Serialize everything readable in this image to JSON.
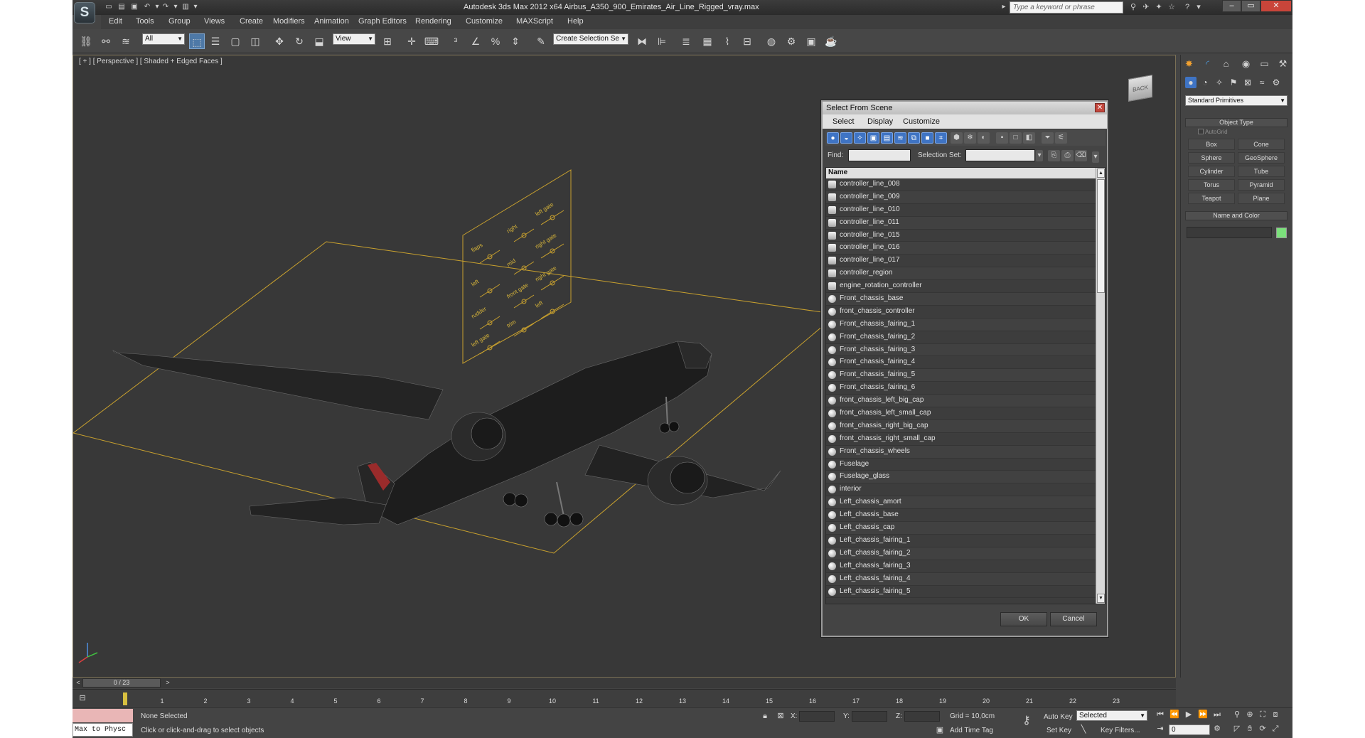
{
  "window": {
    "title": "Autodesk 3ds Max  2012 x64     Airbus_A350_900_Emirates_Air_Line_Rigged_vray.max",
    "search_placeholder": "Type a keyword or phrase",
    "app_logo": "S"
  },
  "menu": [
    "Edit",
    "Tools",
    "Group",
    "Views",
    "Create",
    "Modifiers",
    "Animation",
    "Graph Editors",
    "Rendering",
    "Customize",
    "MAXScript",
    "Help"
  ],
  "toolbar": {
    "filter_combo": "All",
    "ref_coord_combo": "View",
    "named_selection_combo": "Create Selection Se"
  },
  "viewport": {
    "label": "[ + ] [ Perspective ] [ Shaded + Edged Faces ]",
    "viewcube_label": "BACK",
    "rig_labels": [
      "flaps",
      "right",
      "left gate",
      "left",
      "mid",
      "right gate",
      "rudder",
      "front gate",
      "right gate",
      "left gate",
      "trim",
      "left"
    ]
  },
  "dialog": {
    "title": "Select From Scene",
    "menus": [
      "Select",
      "Display",
      "Customize"
    ],
    "find_label": "Find:",
    "selection_set_label": "Selection Set:",
    "column_header": "Name",
    "items": [
      "controller_line_008",
      "controller_line_009",
      "controller_line_010",
      "controller_line_011",
      "controller_line_015",
      "controller_line_016",
      "controller_line_017",
      "controller_region",
      "engine_rotation_controller",
      "Front_chassis_base",
      "front_chassis_controller",
      "Front_chassis_fairing_1",
      "Front_chassis_fairing_2",
      "Front_chassis_fairing_3",
      "Front_chassis_fairing_4",
      "Front_chassis_fairing_5",
      "Front_chassis_fairing_6",
      "front_chassis_left_big_cap",
      "front_chassis_left_small_cap",
      "front_chassis_right_big_cap",
      "front_chassis_right_small_cap",
      "Front_chassis_wheels",
      "Fuselage",
      "Fuselage_glass",
      "interior",
      "Left_chassis_amort",
      "Left_chassis_base",
      "Left_chassis_cap",
      "Left_chassis_fairing_1",
      "Left_chassis_fairing_2",
      "Left_chassis_fairing_3",
      "Left_chassis_fairing_4",
      "Left_chassis_fairing_5"
    ],
    "ok_label": "OK",
    "cancel_label": "Cancel"
  },
  "command_panel": {
    "category_combo": "Standard Primitives",
    "object_type_title": "Object Type",
    "autogrid_label": "AutoGrid",
    "primitives": [
      "Box",
      "Cone",
      "Sphere",
      "GeoSphere",
      "Cylinder",
      "Tube",
      "Torus",
      "Pyramid",
      "Teapot",
      "Plane"
    ],
    "name_color_title": "Name and Color",
    "object_color": "#7be07b"
  },
  "timeline": {
    "frame_display": "0 / 23",
    "ticks": [
      "1",
      "2",
      "3",
      "4",
      "5",
      "6",
      "7",
      "8",
      "9",
      "10",
      "11",
      "12",
      "13",
      "14",
      "15",
      "16",
      "17",
      "18",
      "19",
      "20",
      "21",
      "22",
      "23"
    ]
  },
  "status": {
    "maxscript_text": "Max to Physc",
    "selected_text": "None Selected",
    "prompt_text": "Click or click-and-drag to select objects",
    "x_label": "X:",
    "y_label": "Y:",
    "z_label": "Z:",
    "grid_text": "Grid = 10,0cm",
    "add_time_tag": "Add Time Tag",
    "auto_key": "Auto Key",
    "set_key": "Set Key",
    "selected_combo": "Selected",
    "key_filters": "Key Filters...",
    "frame_value": "0"
  }
}
